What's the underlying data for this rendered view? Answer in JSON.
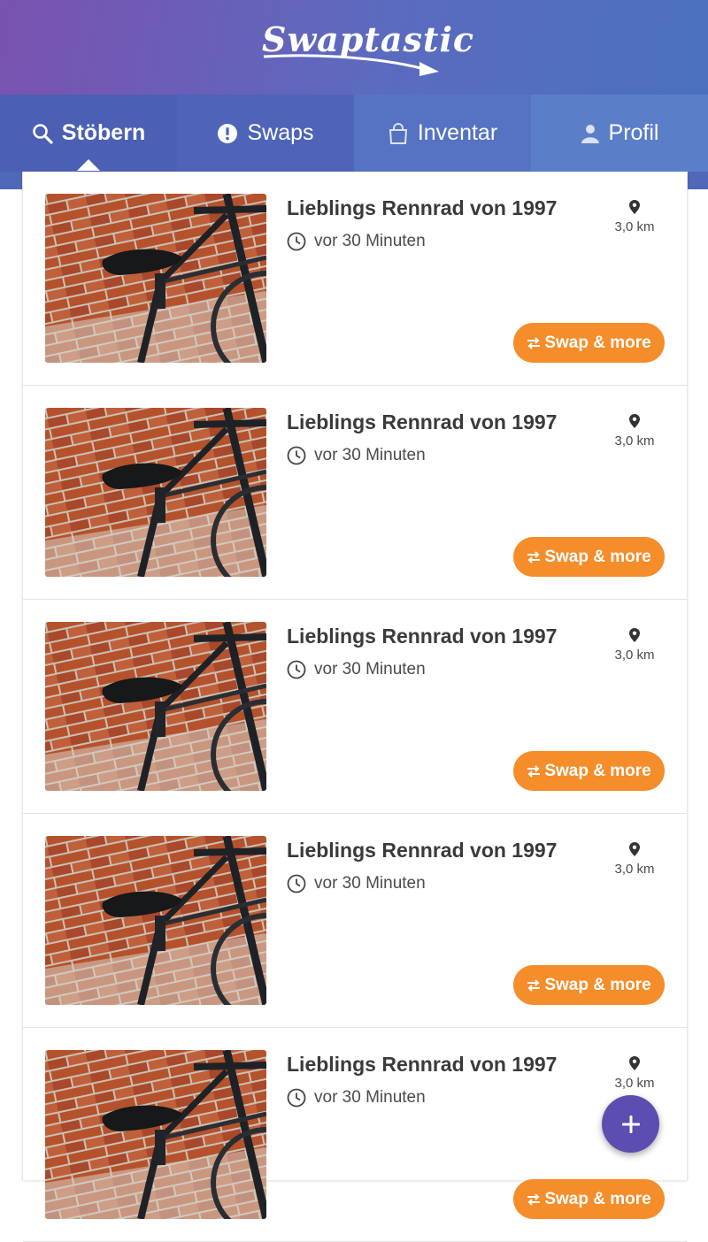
{
  "app": {
    "logo_text": "Swaptastic",
    "accent_color": "#f58d2a",
    "header_color": "#5b6bbf"
  },
  "tabs": [
    {
      "label": "Stöbern",
      "icon": "search-icon",
      "active": true
    },
    {
      "label": "Swaps",
      "icon": "alert-circle-icon",
      "active": false
    },
    {
      "label": "Inventar",
      "icon": "bag-icon",
      "active": false
    },
    {
      "label": "Profil",
      "icon": "person-icon",
      "active": false
    }
  ],
  "listings": [
    {
      "title": "Lieblings Rennrad von 1997",
      "time": "vor 30 Minuten",
      "distance": "3,0 km",
      "button": "Swap & more",
      "image": "bicycle-photo"
    },
    {
      "title": "Lieblings Rennrad von 1997",
      "time": "vor 30 Minuten",
      "distance": "3,0 km",
      "button": "Swap & more",
      "image": "bicycle-photo"
    },
    {
      "title": "Lieblings Rennrad von 1997",
      "time": "vor 30 Minuten",
      "distance": "3,0 km",
      "button": "Swap & more",
      "image": "bicycle-photo"
    },
    {
      "title": "Lieblings Rennrad von 1997",
      "time": "vor 30 Minuten",
      "distance": "3,0 km",
      "button": "Swap & more",
      "image": "bicycle-photo"
    },
    {
      "title": "Lieblings Rennrad von 1997",
      "time": "vor 30 Minuten",
      "distance": "3,0 km",
      "button": "Swap & more",
      "image": "bicycle-photo"
    }
  ],
  "fab": {
    "icon": "plus-icon"
  }
}
